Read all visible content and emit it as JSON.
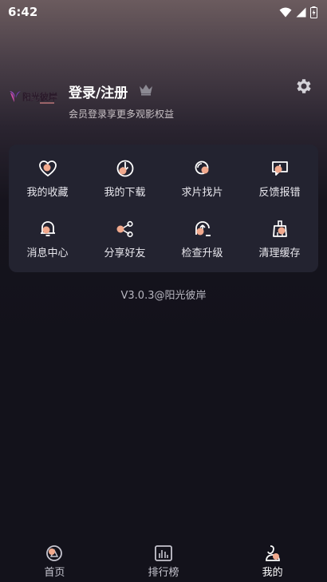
{
  "status_bar": {
    "time": "6:42"
  },
  "profile": {
    "title": "登录/注册",
    "subtitle": "会员登录享更多观影权益",
    "logo_text": "阳光彼岸",
    "logo_icon": "butterfly-logo",
    "crown_icon": "crown-icon",
    "settings_icon": "gear-icon"
  },
  "menu": {
    "items": [
      {
        "label": "我的收藏",
        "icon": "heart-icon"
      },
      {
        "label": "我的下载",
        "icon": "download-icon"
      },
      {
        "label": "求片找片",
        "icon": "search-film-icon"
      },
      {
        "label": "反馈报错",
        "icon": "feedback-icon"
      },
      {
        "label": "消息中心",
        "icon": "bell-icon"
      },
      {
        "label": "分享好友",
        "icon": "share-icon"
      },
      {
        "label": "检查升级",
        "icon": "upgrade-icon"
      },
      {
        "label": "清理缓存",
        "icon": "broom-icon"
      }
    ]
  },
  "version": "V3.0.3@阳光彼岸",
  "bottom_nav": {
    "items": [
      {
        "label": "首页",
        "icon": "home-icon"
      },
      {
        "label": "排行榜",
        "icon": "ranking-icon"
      },
      {
        "label": "我的",
        "icon": "profile-icon"
      }
    ],
    "active": "我的"
  },
  "colors": {
    "accent": "#f1a98d",
    "card": "#232330",
    "background": "#13121b"
  }
}
